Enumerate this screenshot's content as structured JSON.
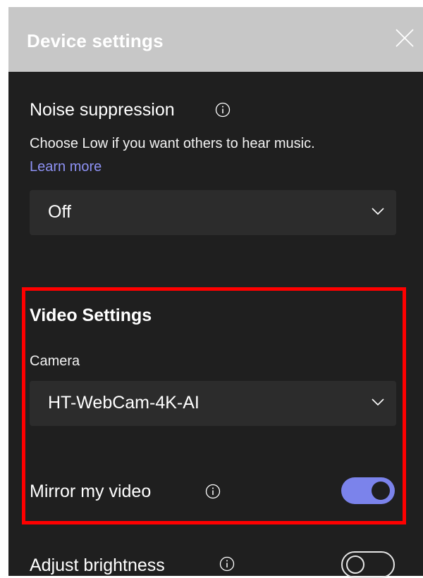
{
  "header": {
    "title": "Device settings"
  },
  "noise_suppression": {
    "title": "Noise suppression",
    "description": "Choose Low if you want others to hear music.",
    "learn_more": "Learn more",
    "selected_value": "Off"
  },
  "video_settings": {
    "heading": "Video Settings",
    "camera_label": "Camera",
    "camera_value": "HT-WebCam-4K-AI",
    "mirror_label": "Mirror my video",
    "mirror_enabled": true
  },
  "brightness": {
    "label": "Adjust brightness",
    "enabled": false
  },
  "icons": {
    "close": "close-icon",
    "info": "info-icon",
    "chevron": "chevron-down-icon"
  },
  "colors": {
    "header_bg": "#c7c7c7",
    "panel_bg": "#1f1f1f",
    "dropdown_bg": "#2c2c2c",
    "accent": "#7b83eb",
    "link": "#8e92f5",
    "highlight": "#ff0000"
  }
}
